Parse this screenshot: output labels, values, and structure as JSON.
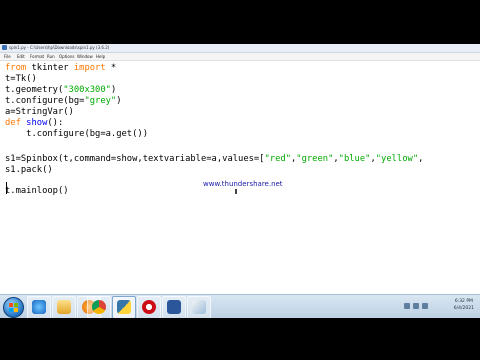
{
  "window": {
    "title": "spin1.py - C:\\Users\\hp\\Downloads\\spin1.py (3.6.2)"
  },
  "menubar": {
    "items": [
      "File",
      "Edit",
      "Format",
      "Run",
      "Options",
      "Window",
      "Help"
    ]
  },
  "code": {
    "line1_kw1": "from",
    "line1_mod": " tkinter ",
    "line1_kw2": "import",
    "line1_rest": " *",
    "line2": "t=Tk()",
    "line3_a": "t.geometry(",
    "line3_str": "\"300x300\"",
    "line3_b": ")",
    "line4_a": "t.configure(bg=",
    "line4_str": "\"grey\"",
    "line4_b": ")",
    "line5": "a=StringVar()",
    "line6_kw": "def",
    "line6_fn": " show",
    "line6_rest": "():",
    "line7": "    t.configure(bg=a.get())",
    "line8_a": "s1=Spinbox(t,command=show,textvariable=a,values=[",
    "line8_s1": "\"red\"",
    "line8_c1": ",",
    "line8_s2": "\"green\"",
    "line8_c2": ",",
    "line8_s3": "\"blue\"",
    "line8_c3": ",",
    "line8_s4": "\"yellow\"",
    "line8_c4": ",",
    "line9": "s1.pack()",
    "line10": "t.mainloop()"
  },
  "watermark": "www.thundershare.net",
  "taskbar": {
    "apps": [
      "start-button",
      "internet-explorer",
      "file-explorer",
      "media-player",
      "chrome",
      "python-idle",
      "opera",
      "word",
      "paint"
    ],
    "clock_time": "6:32 PM",
    "clock_date": "6/4/2021"
  },
  "colors": {
    "keyword": "#ff7700",
    "string": "#00aa00",
    "builtin": "#0000ff"
  }
}
